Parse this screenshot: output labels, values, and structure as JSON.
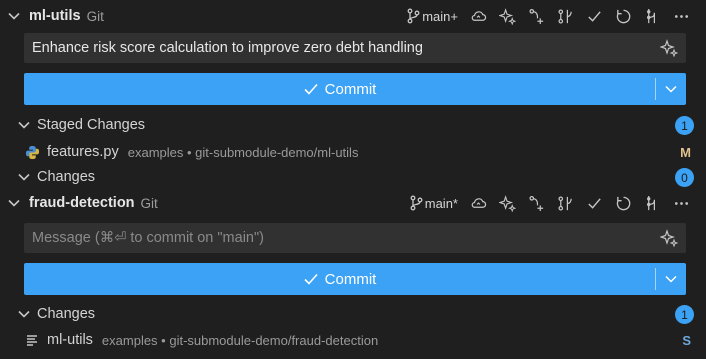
{
  "colors": {
    "accent": "#3ba2f5",
    "modified": "#e2c08d",
    "submodule": "#6fa8dc"
  },
  "repos": [
    {
      "name": "ml-utils",
      "type": "Git",
      "branch": "main+",
      "message": "Enhance risk score calculation to improve zero debt handling",
      "commit_label": "Commit",
      "staged": {
        "title": "Staged Changes",
        "count": "1",
        "files": [
          {
            "name": "features.py",
            "path": "examples • git-submodule-demo/ml-utils",
            "status": "M",
            "icon": "python-icon"
          }
        ]
      },
      "changes": {
        "title": "Changes",
        "count": "0"
      }
    },
    {
      "name": "fraud-detection",
      "type": "Git",
      "branch": "main*",
      "message_placeholder": "Message (⌘⏎ to commit on \"main\")",
      "commit_label": "Commit",
      "changes": {
        "title": "Changes",
        "count": "1",
        "files": [
          {
            "name": "ml-utils",
            "path": "examples • git-submodule-demo/fraud-detection",
            "status": "S",
            "icon": "submodule-icon"
          }
        ]
      }
    }
  ]
}
